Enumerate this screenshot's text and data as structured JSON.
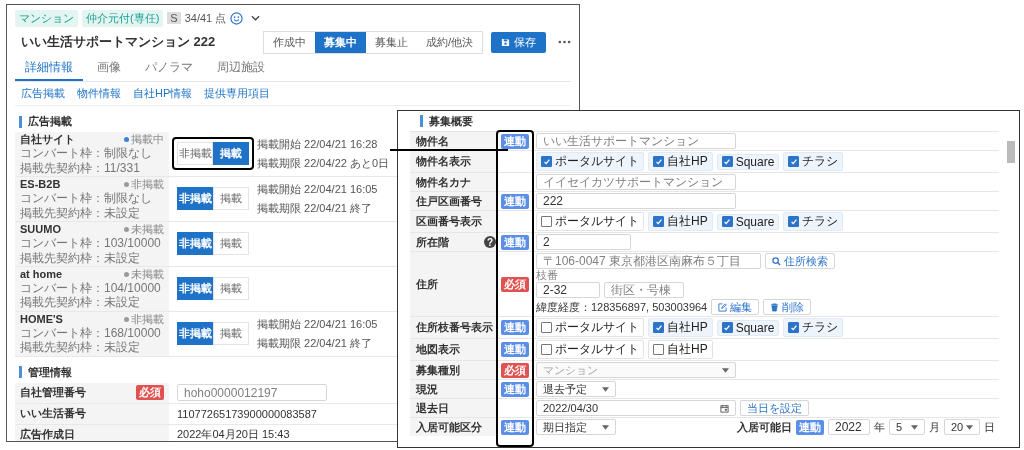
{
  "main_window": {
    "tags": [
      "マンション",
      "仲介元付(専任)"
    ],
    "rank": "S",
    "score": "34/41 点",
    "title": "いい生活サポートマンション 222",
    "status_buttons": [
      {
        "label": "作成中",
        "selected": false
      },
      {
        "label": "募集中",
        "selected": true
      },
      {
        "label": "募集止",
        "selected": false
      },
      {
        "label": "成約/他決",
        "selected": false
      }
    ],
    "save_button": "保存",
    "tabs": [
      {
        "label": "詳細情報",
        "selected": true
      },
      {
        "label": "画像",
        "selected": false
      },
      {
        "label": "パノラマ",
        "selected": false
      },
      {
        "label": "周辺施設",
        "selected": false
      }
    ],
    "anchor_links": [
      "広告掲載",
      "物件情報",
      "自社HP情報",
      "提供専用項目"
    ],
    "ad_section": {
      "title": "広告掲載",
      "rows": [
        {
          "name": "自社サイト",
          "status": "掲載中",
          "color": "#3d7fd6",
          "convert": "コンバート枠：制限なし",
          "contract": "掲載先契約枠：11/331",
          "highlighted": true,
          "options": [
            {
              "label": "非掲載",
              "selected": false
            },
            {
              "label": "掲載",
              "selected": true
            }
          ],
          "lines": [
            "掲載開始 22/04/21 16:28",
            "掲載期限 22/04/22 あと0日"
          ]
        },
        {
          "name": "ES-B2B",
          "status": "非掲載",
          "color": "#9a9a9a",
          "convert": "コンバート枠：制限なし",
          "contract": "掲載先契約枠：未設定",
          "options": [
            {
              "label": "非掲載",
              "selected": true
            },
            {
              "label": "掲載",
              "selected": false
            }
          ],
          "lines": [
            "掲載開始 22/04/21 16:05",
            "掲載期限 22/04/21 終了"
          ]
        },
        {
          "name": "SUUMO",
          "status": "未掲載",
          "color": "#9a9a9a",
          "convert": "コンバート枠：103/10000",
          "contract": "掲載先契約枠：未設定",
          "options": [
            {
              "label": "非掲載",
              "selected": true
            },
            {
              "label": "掲載",
              "selected": false
            }
          ],
          "lines": []
        },
        {
          "name": "at home",
          "status": "未掲載",
          "color": "#9a9a9a",
          "convert": "コンバート枠：104/10000",
          "contract": "掲載先契約枠：未設定",
          "options": [
            {
              "label": "非掲載",
              "selected": true
            },
            {
              "label": "掲載",
              "selected": false
            }
          ],
          "lines": []
        },
        {
          "name": "HOME'S",
          "status": "非掲載",
          "color": "#9a9a9a",
          "convert": "コンバート枠：168/10000",
          "contract": "掲載先契約枠：未設定",
          "options": [
            {
              "label": "非掲載",
              "selected": true
            },
            {
              "label": "掲載",
              "selected": false
            }
          ],
          "lines": [
            "掲載開始 22/04/21 16:05",
            "掲載期限 22/04/21 終了"
          ]
        }
      ]
    },
    "management_section": {
      "title": "管理情報",
      "rows": [
        {
          "kind": "input",
          "label": "自社管理番号",
          "badge": {
            "kind": "required",
            "label": "必須"
          },
          "placeholder": "hoho0000012197"
        },
        {
          "kind": "text",
          "label": "いい生活番号",
          "value": "11077265173900000083587"
        },
        {
          "kind": "text",
          "label": "広告作成日",
          "value": "2022年04月20日 15:43"
        }
      ]
    }
  },
  "detail_window": {
    "section_title": "募集概要",
    "badge_column_highlighted": true,
    "rows": [
      {
        "kind": "text",
        "label": "物件名",
        "badge": {
          "kind": "sync",
          "label": "連動"
        },
        "placeholder": "いい生活サポートマンション"
      },
      {
        "kind": "checks",
        "label": "物件名表示",
        "options": [
          {
            "label": "ポータルサイト",
            "checked": true
          },
          {
            "label": "自社HP",
            "checked": true
          },
          {
            "label": "Square",
            "checked": true
          },
          {
            "label": "チラシ",
            "checked": true
          }
        ]
      },
      {
        "kind": "text",
        "label": "物件名カナ",
        "placeholder": "イイセイカツサポートマンション"
      },
      {
        "kind": "text",
        "label": "住戸区画番号",
        "badge": {
          "kind": "sync",
          "label": "連動"
        },
        "value": "222"
      },
      {
        "kind": "checks",
        "label": "区画番号表示",
        "options": [
          {
            "label": "ポータルサイト",
            "checked": false
          },
          {
            "label": "自社HP",
            "checked": true
          },
          {
            "label": "Square",
            "checked": true
          },
          {
            "label": "チラシ",
            "checked": true
          }
        ]
      },
      {
        "kind": "short-text",
        "label": "所在階",
        "help": "?",
        "badge": {
          "kind": "sync",
          "label": "連動"
        },
        "value": "2"
      },
      {
        "kind": "address",
        "label": "住所",
        "badge": {
          "kind": "required",
          "label": "必須"
        },
        "postal_placeholder": "〒106-0047 東京都港区南麻布５丁目",
        "search_button": "住所検索",
        "branch_label": "枝番",
        "branch_value": "2-32",
        "block_placeholder": "街区・号棟",
        "coordinates": "緯度経度：128356897, 503003964",
        "edit_button": "編集",
        "delete_button": "削除"
      },
      {
        "kind": "checks",
        "label": "住所枝番号表示",
        "badge": {
          "kind": "sync",
          "label": "連動"
        },
        "options": [
          {
            "label": "ポータルサイト",
            "checked": false
          },
          {
            "label": "自社HP",
            "checked": true
          },
          {
            "label": "Square",
            "checked": true
          },
          {
            "label": "チラシ",
            "checked": true
          }
        ]
      },
      {
        "kind": "checks",
        "label": "地図表示",
        "badge": {
          "kind": "sync",
          "label": "連動"
        },
        "options": [
          {
            "label": "ポータルサイト",
            "checked": false
          },
          {
            "label": "自社HP",
            "checked": false
          }
        ]
      },
      {
        "kind": "wide-select",
        "label": "募集種別",
        "badge": {
          "kind": "required",
          "label": "必須"
        },
        "value": "マンション",
        "disabled": true
      },
      {
        "kind": "select",
        "label": "現況",
        "badge": {
          "kind": "sync",
          "label": "連動"
        },
        "value": "退去予定",
        "disabled": false
      },
      {
        "kind": "date",
        "label": "退去日",
        "value": "2022/04/30",
        "button": "当日を設定"
      },
      {
        "kind": "move-in",
        "label": "入居可能区分",
        "badge": {
          "kind": "sync",
          "label": "連動"
        },
        "value": "期日指定",
        "date_label": "入居可能日",
        "date_badge": {
          "kind": "sync",
          "label": "連動"
        },
        "year": "2022",
        "year_unit": "年",
        "month": "5",
        "month_unit": "月",
        "day": "20",
        "day_unit": "日"
      }
    ]
  }
}
